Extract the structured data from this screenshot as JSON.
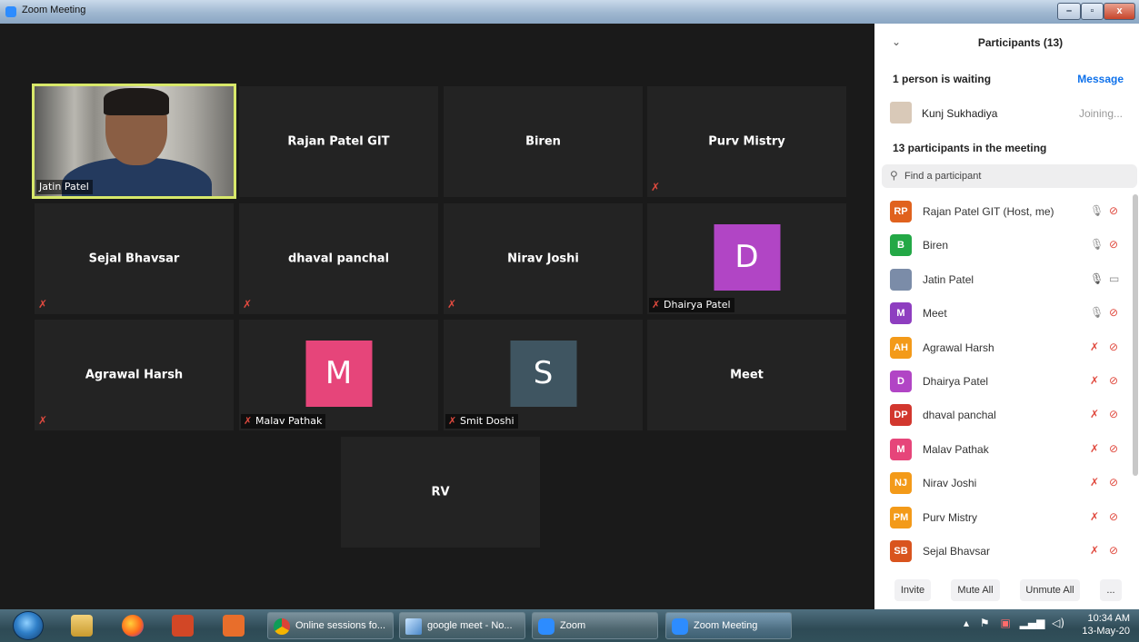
{
  "window": {
    "title": "Zoom Meeting",
    "minimize": "–",
    "maximize": "▫",
    "close": "x"
  },
  "gallery": {
    "tiles": [
      {
        "name": "Jatin Patel"
      },
      {
        "name": "Rajan Patel GIT"
      },
      {
        "name": "Biren"
      },
      {
        "name": "Purv Mistry"
      },
      {
        "name": "Sejal Bhavsar"
      },
      {
        "name": "dhaval panchal"
      },
      {
        "name": "Nirav Joshi"
      },
      {
        "name": "Dhairya Patel",
        "initial": "D",
        "color": "#b145c5"
      },
      {
        "name": "Agrawal Harsh"
      },
      {
        "name": "Malav Pathak",
        "initial": "M",
        "color": "#e6457a"
      },
      {
        "name": "Smit Doshi",
        "initial": "S",
        "color": "#3f5561"
      },
      {
        "name": "Meet"
      },
      {
        "name": "RV"
      }
    ]
  },
  "panel": {
    "title": "Participants (13)",
    "collapse_icon": "chevron-down-icon",
    "waiting_text": "1 person is waiting",
    "message_label": "Message",
    "waiting_person": {
      "name": "Kunj Sukhadiya",
      "status": "Joining..."
    },
    "count_text": "13 participants in the meeting",
    "search_placeholder": "Find a participant",
    "participants": [
      {
        "initials": "RP",
        "name": "Rajan Patel GIT (Host, me)",
        "color": "#e0621e",
        "mic": "on",
        "video": "off"
      },
      {
        "initials": "B",
        "name": "Biren",
        "color": "#23a846",
        "mic": "on",
        "video": "off"
      },
      {
        "initials": "",
        "name": "Jatin Patel",
        "color": "#7b8ca8",
        "mic": "live",
        "video": "on"
      },
      {
        "initials": "M",
        "name": "Meet",
        "color": "#8e3ec0",
        "mic": "off",
        "video": "off"
      },
      {
        "initials": "AH",
        "name": "Agrawal Harsh",
        "color": "#f39a19",
        "mic": "off",
        "video": "off"
      },
      {
        "initials": "D",
        "name": "Dhairya Patel",
        "color": "#b145c5",
        "mic": "off",
        "video": "off"
      },
      {
        "initials": "DP",
        "name": "dhaval panchal",
        "color": "#d2372e",
        "mic": "off",
        "video": "off"
      },
      {
        "initials": "M",
        "name": "Malav Pathak",
        "color": "#e6457a",
        "mic": "off",
        "video": "off"
      },
      {
        "initials": "NJ",
        "name": "Nirav Joshi",
        "color": "#f39a19",
        "mic": "off",
        "video": "off"
      },
      {
        "initials": "PM",
        "name": "Purv Mistry",
        "color": "#f39a19",
        "mic": "off",
        "video": "off"
      },
      {
        "initials": "SB",
        "name": "Sejal Bhavsar",
        "color": "#d9541e",
        "mic": "off",
        "video": "off"
      }
    ],
    "footer": {
      "invite": "Invite",
      "mute_all": "Mute All",
      "unmute_all": "Unmute All",
      "more": "..."
    }
  },
  "taskbar": {
    "tasks": [
      {
        "label": "Online sessions fo..."
      },
      {
        "label": "google meet - No..."
      },
      {
        "label": "Zoom"
      },
      {
        "label": "Zoom Meeting"
      }
    ],
    "time": "10:34 AM",
    "date": "13-May-20"
  }
}
